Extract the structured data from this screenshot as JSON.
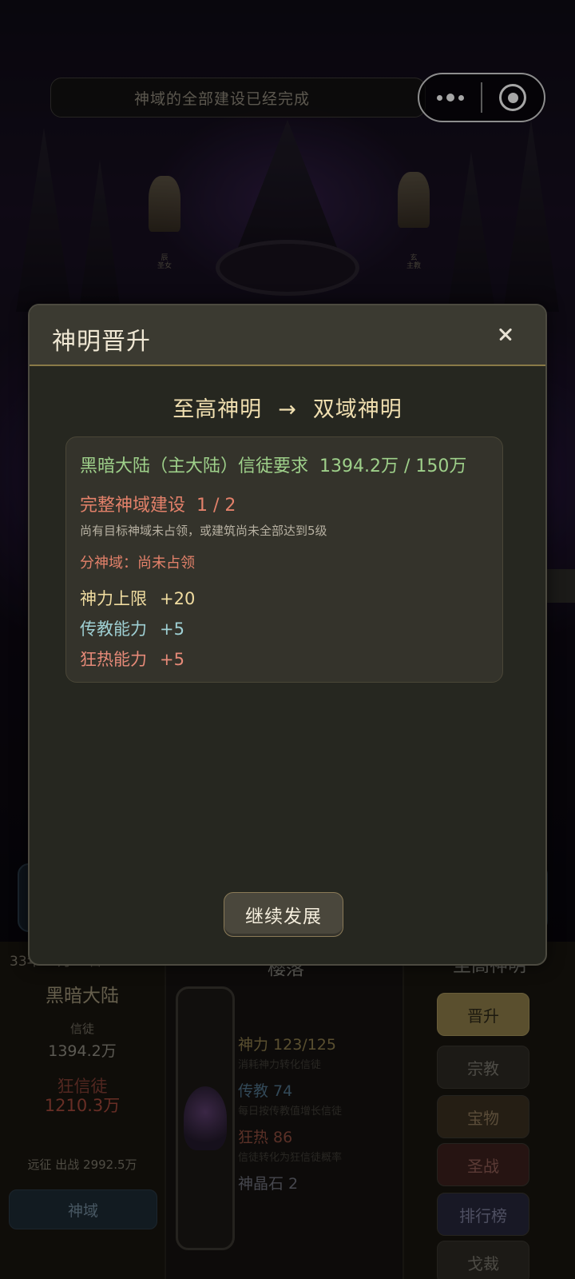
{
  "top_bar": {
    "notice": "神域的全部建设已经完成",
    "more_icon": "more-dots-icon",
    "close_icon": "target-close-icon"
  },
  "scene": {
    "left_statue_label": "辰\n圣女",
    "right_statue_label": "玄\n主教"
  },
  "modal": {
    "title": "神明晋升",
    "close_icon": "close-icon",
    "from_rank": "至高神明",
    "arrow": "→",
    "to_rank": "双域神明",
    "requirements": {
      "believers_label": "黑暗大陆（主大陆）信徒要求",
      "believers_value": "1394.2万 / 150万",
      "domain_label": "完整神域建设",
      "domain_value": "1 / 2",
      "domain_note": "尚有目标神域未占领，或建筑尚未全部达到5级",
      "sub_domain": "分神域：尚未占领"
    },
    "rewards": [
      {
        "label": "神力上限",
        "value": "+20"
      },
      {
        "label": "传教能力",
        "value": "+5"
      },
      {
        "label": "狂热能力",
        "value": "+5"
      }
    ],
    "continue_label": "继续发展"
  },
  "bottom": {
    "date": "33年11月18日",
    "continent": "黑暗大陆",
    "believers_label": "信徒",
    "believers_value": "1394.2万",
    "fanatics_label": "狂信徒",
    "fanatics_value": "1210.3万",
    "expedition": "远征 出战 2992.5万",
    "domain_button": "神域",
    "deity_name": "樱落",
    "stats": {
      "divine_power": "神力 123/125",
      "divine_power_sub": "消耗神力转化信徒",
      "preach": "传教 74",
      "preach_sub": "每日按传教值增长信徒",
      "fanatic": "狂热 86",
      "fanatic_sub": "信徒转化为狂信徒概率",
      "crystal": "神晶石 2"
    },
    "rank_title": "至高神明",
    "menu": [
      "晋升",
      "宗教",
      "宝物",
      "圣战",
      "排行榜",
      "戈裁"
    ]
  }
}
